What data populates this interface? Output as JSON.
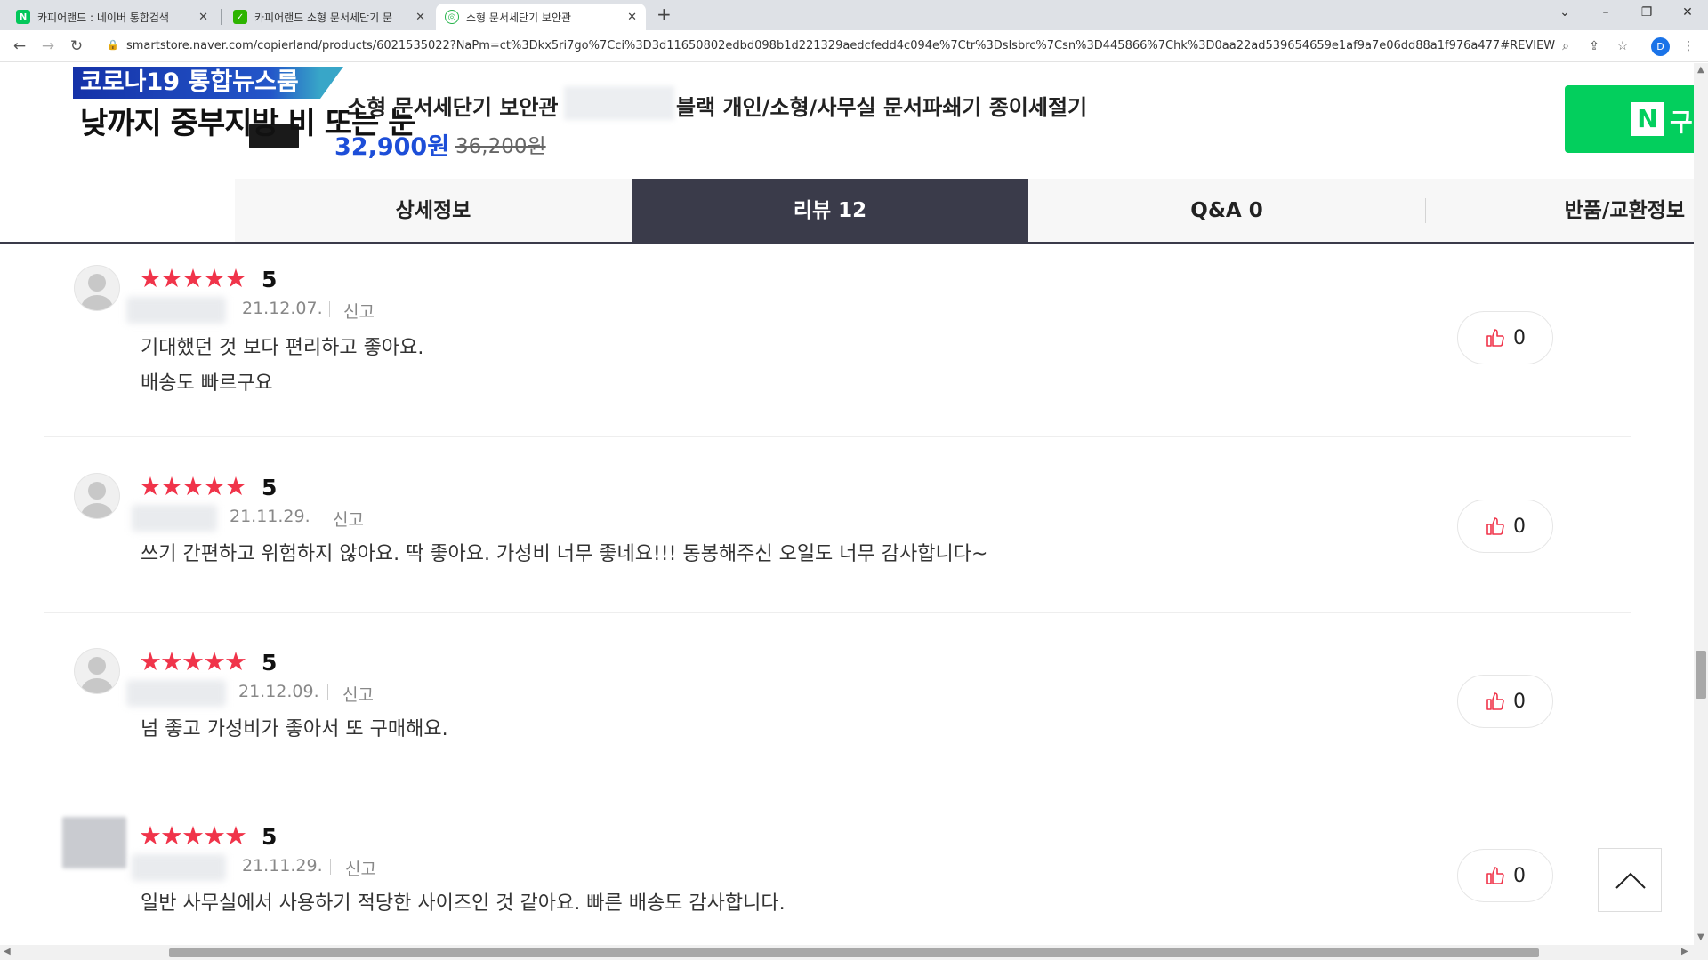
{
  "browser": {
    "tabs": [
      {
        "title": "카피어랜드 : 네이버 통합검색",
        "favicon": "N",
        "color": "#03c75a"
      },
      {
        "title": "카피어랜드 소형 문서세단기 문",
        "favicon": "✓",
        "color": "#2db400"
      },
      {
        "title": "소형 문서세단기 보안관",
        "favicon": "◎",
        "color": "#25b34a"
      }
    ],
    "url": "smartstore.naver.com/copierland/products/6021535022?NaPm=ct%3Dkx5ri7go%7Cci%3D3d11650802edbd098b1d221329aedcfedd4c094e%7Ctr%3Dslsbrc%7Csn%3D445866%7Chk%3D0aa22ad539654659e1af9a7e06dd88a1f976a477#REVIEW",
    "profile_initial": "D"
  },
  "news_overlay": {
    "badge": "코로나19 통합뉴스룸",
    "ticker": "낮까지 중부지방 비 또는 눈"
  },
  "product": {
    "title_a": "소형 문서세단기 보안관",
    "title_b": "블랙 개인/소형/사무실 문서파쇄기 종이세절기",
    "price": "32,900원",
    "original_price": "36,200원",
    "buy_label": "구매하기"
  },
  "product_tabs": [
    {
      "label": "상세정보",
      "active": false
    },
    {
      "label": "리뷰 12",
      "active": true
    },
    {
      "label": "Q&A 0",
      "active": false
    },
    {
      "label": "반품/교환정보",
      "active": false
    }
  ],
  "reviews": [
    {
      "stars": "★★★★★",
      "score": "5",
      "date": "21.12.07.",
      "report": "신고",
      "lines": [
        "기대했던 것 보다 편리하고 좋아요.",
        "배송도 빠르구요"
      ],
      "likes": "0"
    },
    {
      "stars": "★★★★★",
      "score": "5",
      "date": "21.11.29.",
      "report": "신고",
      "lines": [
        "쓰기 간편하고 위험하지 않아요. 딱 좋아요. 가성비 너무 좋네요!!!  동봉해주신 오일도 너무 감사합니다~"
      ],
      "likes": "0"
    },
    {
      "stars": "★★★★★",
      "score": "5",
      "date": "21.12.09.",
      "report": "신고",
      "lines": [
        "넘 좋고 가성비가 좋아서 또 구매해요."
      ],
      "likes": "0"
    },
    {
      "stars": "★★★★★",
      "score": "5",
      "date": "21.11.29.",
      "report": "신고",
      "lines": [
        "일반 사무실에서 사용하기 적당한 사이즈인 것 같아요. 빠른 배송도 감사합니다."
      ],
      "likes": "0"
    }
  ],
  "colors": {
    "accent_star": "#f0344a",
    "active_tab": "#3a3b4a",
    "naver_green": "#03cf5d",
    "price_blue": "#1d4ed8"
  }
}
